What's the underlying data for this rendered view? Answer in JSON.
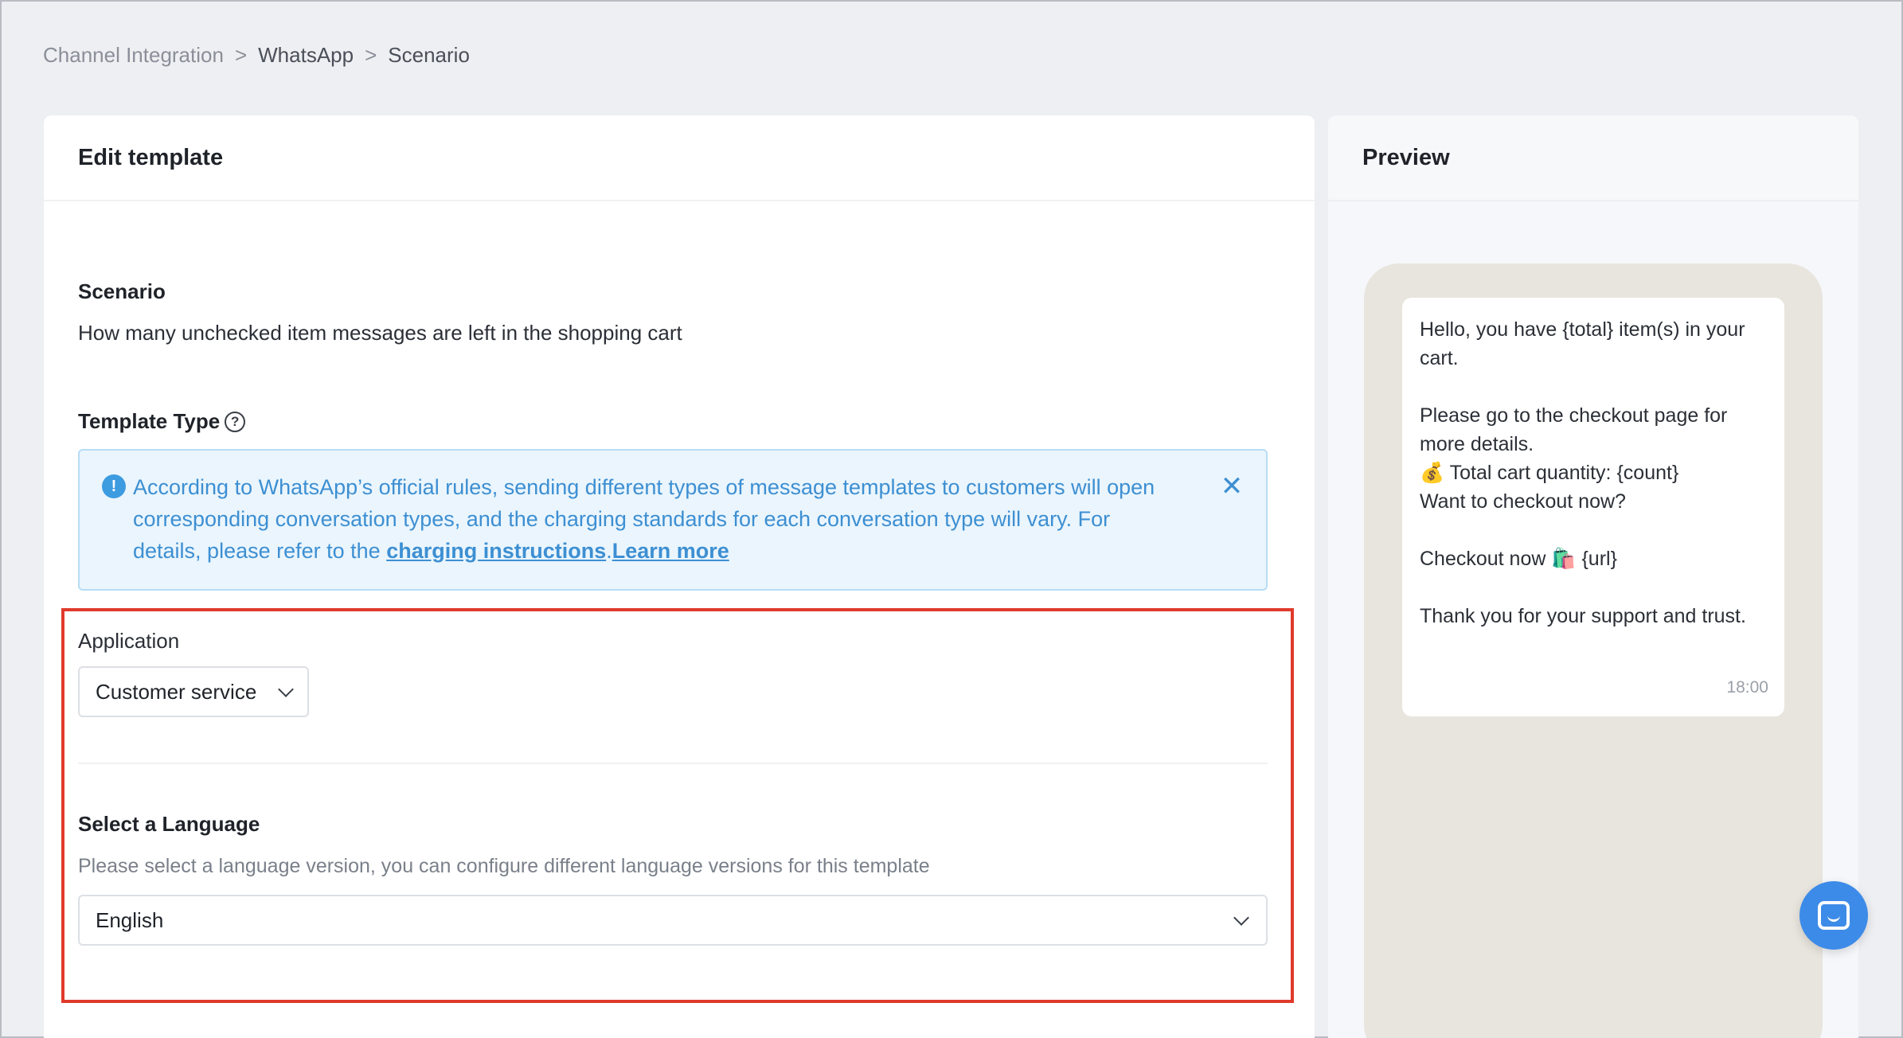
{
  "breadcrumb": {
    "items": [
      "Channel Integration",
      "WhatsApp",
      "Scenario"
    ],
    "separator": ">"
  },
  "edit": {
    "title": "Edit template",
    "scenario_label": "Scenario",
    "scenario_value": "How many unchecked item messages are left in the shopping cart",
    "template_type_label": "Template Type",
    "notice": {
      "text": "According to WhatsApp’s official rules, sending different types of message templates to customers will open corresponding conversation types, and the charging standards for each conversation type will vary. For details, please refer to the ",
      "link1": "charging instructions",
      "period": ".",
      "link2": "Learn more"
    },
    "application_label": "Application",
    "application_value": "Customer service",
    "language_label": "Select a Language",
    "language_desc": "Please select a language version, you can configure different language versions for this template",
    "language_value": "English"
  },
  "preview": {
    "title": "Preview",
    "lines": [
      "Hello, you have {total} item(s) in your cart.",
      "",
      "Please go to the checkout page for more details.",
      "💰 Total cart quantity: {count}",
      "Want to checkout now?",
      "",
      "Checkout now 🛍️ {url}",
      "",
      "Thank you for your support and trust."
    ],
    "time": "18:00"
  },
  "colors": {
    "highlight_border": "#e03a2c",
    "notice_text": "#3d8fd2",
    "fab": "#3d8be8"
  }
}
